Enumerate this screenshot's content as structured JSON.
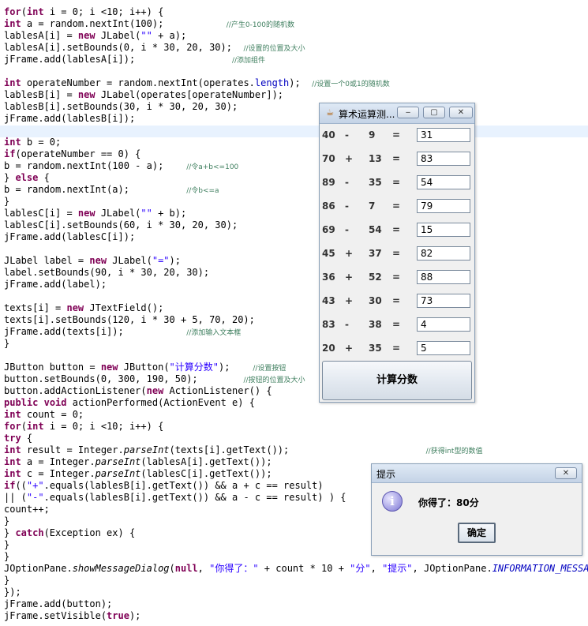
{
  "code_editor": {
    "lines": [
      [
        {
          "t": "for",
          "c": "kw"
        },
        {
          "t": "(",
          "c": ""
        },
        {
          "t": "int",
          "c": "kw"
        },
        {
          "t": " i = 0; i <10; i++) {",
          "c": ""
        }
      ],
      [
        {
          "t": "int",
          "c": "kw"
        },
        {
          "t": " a = random.nextInt(100);           ",
          "c": ""
        },
        {
          "t": "//产生0-100的随机数",
          "c": "cm"
        }
      ],
      [
        {
          "t": "lablesA[i] = ",
          "c": ""
        },
        {
          "t": "new",
          "c": "kw"
        },
        {
          "t": " JLabel(",
          "c": ""
        },
        {
          "t": "\"\"",
          "c": "str"
        },
        {
          "t": " + a);",
          "c": ""
        }
      ],
      [
        {
          "t": "lablesA[i].setBounds(0, i * 30, 20, 30);  ",
          "c": ""
        },
        {
          "t": "//设置的位置及大小",
          "c": "cm"
        }
      ],
      [
        {
          "t": "jFrame.add(lablesA[i]);                 ",
          "c": ""
        },
        {
          "t": "//添加组件",
          "c": "cm"
        }
      ],
      [],
      [
        {
          "t": "int",
          "c": "kw"
        },
        {
          "t": " operateNumber = random.nextInt(operates.",
          "c": ""
        },
        {
          "t": "length",
          "c": "fld"
        },
        {
          "t": ");  ",
          "c": ""
        },
        {
          "t": "//设置一个0或1的随机数",
          "c": "cm"
        }
      ],
      [
        {
          "t": "lablesB[i] = ",
          "c": ""
        },
        {
          "t": "new",
          "c": "kw"
        },
        {
          "t": " JLabel(operates[operateNumber]);",
          "c": ""
        }
      ],
      [
        {
          "t": "lablesB[i].setBounds(30, i * 30, 20, 30);",
          "c": ""
        }
      ],
      [
        {
          "t": "jFrame.add(lablesB[i]);",
          "c": ""
        }
      ],
      [],
      [
        {
          "t": "int",
          "c": "kw"
        },
        {
          "t": " b = 0;",
          "c": ""
        }
      ],
      [
        {
          "t": "if",
          "c": "kw"
        },
        {
          "t": "(operateNumber == 0) {",
          "c": ""
        }
      ],
      [
        {
          "t": "b = random.nextInt(100 - a);    ",
          "c": ""
        },
        {
          "t": "//令a+b<=100",
          "c": "cm"
        }
      ],
      [
        {
          "t": "} ",
          "c": ""
        },
        {
          "t": "else",
          "c": "kw"
        },
        {
          "t": " {",
          "c": ""
        }
      ],
      [
        {
          "t": "b = random.nextInt(a);          ",
          "c": ""
        },
        {
          "t": "//令b<=a",
          "c": "cm"
        }
      ],
      [
        {
          "t": "}",
          "c": ""
        }
      ],
      [
        {
          "t": "lablesC[i] = ",
          "c": ""
        },
        {
          "t": "new",
          "c": "kw"
        },
        {
          "t": " JLabel(",
          "c": ""
        },
        {
          "t": "\"\"",
          "c": "str"
        },
        {
          "t": " + b);",
          "c": ""
        }
      ],
      [
        {
          "t": "lablesC[i].setBounds(60, i * 30, 20, 30);",
          "c": ""
        }
      ],
      [
        {
          "t": "jFrame.add(lablesC[i]);",
          "c": ""
        }
      ],
      [],
      [
        {
          "t": "JLabel label = ",
          "c": ""
        },
        {
          "t": "new",
          "c": "kw"
        },
        {
          "t": " JLabel(",
          "c": ""
        },
        {
          "t": "\"=\"",
          "c": "str"
        },
        {
          "t": ");",
          "c": ""
        }
      ],
      [
        {
          "t": "label.setBounds(90, i * 30, 20, 30);",
          "c": ""
        }
      ],
      [
        {
          "t": "jFrame.add(label);",
          "c": ""
        }
      ],
      [],
      [
        {
          "t": "texts[i] = ",
          "c": ""
        },
        {
          "t": "new",
          "c": "kw"
        },
        {
          "t": " JTextField();",
          "c": ""
        }
      ],
      [
        {
          "t": "texts[i].setBounds(120, i * 30 + 5, 70, 20);",
          "c": ""
        }
      ],
      [
        {
          "t": "jFrame.add(texts[i]);           ",
          "c": ""
        },
        {
          "t": "//添加输入文本框",
          "c": "cm"
        }
      ],
      [
        {
          "t": "}",
          "c": ""
        }
      ],
      [],
      [
        {
          "t": "JButton button = ",
          "c": ""
        },
        {
          "t": "new",
          "c": "kw"
        },
        {
          "t": " JButton(",
          "c": ""
        },
        {
          "t": "\"计算分数\"",
          "c": "str"
        },
        {
          "t": ");    ",
          "c": ""
        },
        {
          "t": "//设置按钮",
          "c": "cm"
        }
      ],
      [
        {
          "t": "button.setBounds(0, 300, 190, 50);        ",
          "c": ""
        },
        {
          "t": "//按钮的位置及大小",
          "c": "cm"
        }
      ],
      [
        {
          "t": "button.addActionListener(",
          "c": ""
        },
        {
          "t": "new",
          "c": "kw"
        },
        {
          "t": " ActionListener() {",
          "c": ""
        }
      ],
      [
        {
          "t": "public",
          "c": "kw"
        },
        {
          "t": " ",
          "c": ""
        },
        {
          "t": "void",
          "c": "kw"
        },
        {
          "t": " actionPerformed(ActionEvent e) {",
          "c": ""
        }
      ],
      [
        {
          "t": "int",
          "c": "kw"
        },
        {
          "t": " count = 0;",
          "c": ""
        }
      ],
      [
        {
          "t": "for",
          "c": "kw"
        },
        {
          "t": "(",
          "c": ""
        },
        {
          "t": "int",
          "c": "kw"
        },
        {
          "t": " i = 0; i <10; i++) {",
          "c": ""
        }
      ],
      [
        {
          "t": "try",
          "c": "kw"
        },
        {
          "t": " {",
          "c": ""
        }
      ],
      [
        {
          "t": "int",
          "c": "kw"
        },
        {
          "t": " result = Integer.",
          "c": ""
        },
        {
          "t": "parseInt",
          "c": "it"
        },
        {
          "t": "(texts[i].getText());                        ",
          "c": ""
        },
        {
          "t": "//获得int型的数值",
          "c": "cm"
        }
      ],
      [
        {
          "t": "int",
          "c": "kw"
        },
        {
          "t": " a = Integer.",
          "c": ""
        },
        {
          "t": "parseInt",
          "c": "it"
        },
        {
          "t": "(lablesA[i].getText());",
          "c": ""
        }
      ],
      [
        {
          "t": "int",
          "c": "kw"
        },
        {
          "t": " c = Integer.",
          "c": ""
        },
        {
          "t": "parseInt",
          "c": "it"
        },
        {
          "t": "(lablesC[i].getText());",
          "c": ""
        }
      ],
      [
        {
          "t": "if",
          "c": "kw"
        },
        {
          "t": "((",
          "c": ""
        },
        {
          "t": "\"+\"",
          "c": "str"
        },
        {
          "t": ".equals(lablesB[i].getText()) && a + c == result)",
          "c": ""
        }
      ],
      [
        {
          "t": "|| (",
          "c": ""
        },
        {
          "t": "\"-\"",
          "c": "str"
        },
        {
          "t": ".equals(lablesB[i].getText()) && a - c == result) ) {",
          "c": ""
        }
      ],
      [
        {
          "t": "count++;",
          "c": ""
        }
      ],
      [
        {
          "t": "}",
          "c": ""
        }
      ],
      [
        {
          "t": "} ",
          "c": ""
        },
        {
          "t": "catch",
          "c": "kw"
        },
        {
          "t": "(Exception ex) {",
          "c": ""
        }
      ],
      [
        {
          "t": "}",
          "c": ""
        }
      ],
      [
        {
          "t": "}",
          "c": ""
        }
      ],
      [
        {
          "t": "JOptionPane.",
          "c": ""
        },
        {
          "t": "showMessageDialog",
          "c": "it"
        },
        {
          "t": "(",
          "c": ""
        },
        {
          "t": "null",
          "c": "kw"
        },
        {
          "t": ", ",
          "c": ""
        },
        {
          "t": "\"你得了：\"",
          "c": "str"
        },
        {
          "t": " + count * 10 + ",
          "c": ""
        },
        {
          "t": "\"分\"",
          "c": "str"
        },
        {
          "t": ", ",
          "c": ""
        },
        {
          "t": "\"提示\"",
          "c": "str"
        },
        {
          "t": ", JOptionPane.",
          "c": ""
        },
        {
          "t": "INFORMATION_MESSAGE",
          "c": "fi"
        },
        {
          "t": ");",
          "c": ""
        }
      ],
      [
        {
          "t": "}",
          "c": ""
        }
      ],
      [
        {
          "t": "});",
          "c": ""
        }
      ],
      [
        {
          "t": "jFrame.add(button);",
          "c": ""
        }
      ],
      [
        {
          "t": "jFrame.setVisible(",
          "c": ""
        },
        {
          "t": "true",
          "c": "kw"
        },
        {
          "t": ");",
          "c": ""
        }
      ]
    ]
  },
  "app_window": {
    "title": "算术运算测...",
    "min_label": "‒",
    "max_label": "▢",
    "close_label": "✕",
    "rows": [
      {
        "a": "40",
        "op": "-",
        "b": "9",
        "eq": "=",
        "answer": "31"
      },
      {
        "a": "70",
        "op": "+",
        "b": "13",
        "eq": "=",
        "answer": "83"
      },
      {
        "a": "89",
        "op": "-",
        "b": "35",
        "eq": "=",
        "answer": "54"
      },
      {
        "a": "86",
        "op": "-",
        "b": "7",
        "eq": "=",
        "answer": "79"
      },
      {
        "a": "69",
        "op": "-",
        "b": "54",
        "eq": "=",
        "answer": "15"
      },
      {
        "a": "45",
        "op": "+",
        "b": "37",
        "eq": "=",
        "answer": "82"
      },
      {
        "a": "36",
        "op": "+",
        "b": "52",
        "eq": "=",
        "answer": "88"
      },
      {
        "a": "43",
        "op": "+",
        "b": "30",
        "eq": "=",
        "answer": "73"
      },
      {
        "a": "83",
        "op": "-",
        "b": "38",
        "eq": "=",
        "answer": "4"
      },
      {
        "a": "20",
        "op": "+",
        "b": "35",
        "eq": "=",
        "answer": "5"
      }
    ],
    "calc_button_label": "计算分数"
  },
  "message_dialog": {
    "title": "提示",
    "close_label": "✕",
    "icon_glyph": "i",
    "message": "你得了：80分",
    "ok_label": "确定"
  }
}
